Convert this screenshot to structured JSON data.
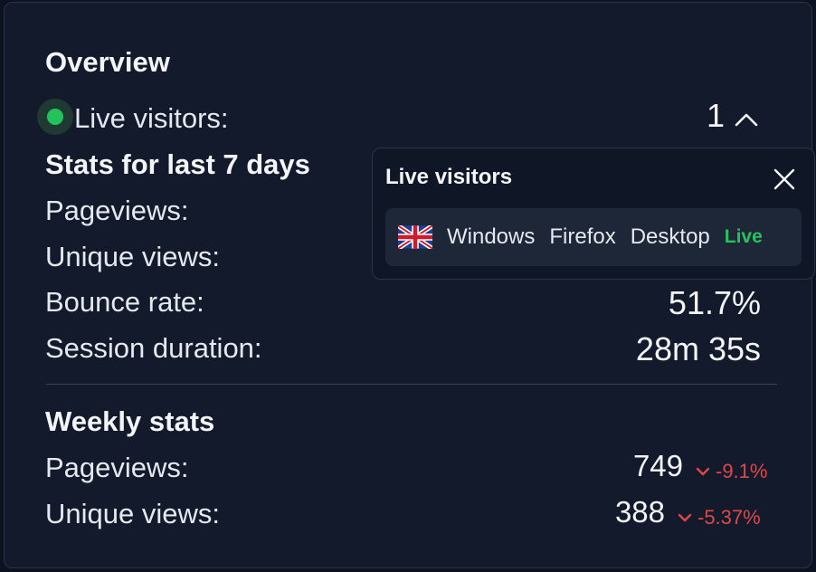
{
  "overview": {
    "title": "Overview",
    "live_label": "Live visitors:",
    "live_count": "1",
    "stats_title": "Stats for last 7 days",
    "pageviews_label": "Pageviews:",
    "unique_label": "Unique views:",
    "bounce_label": "Bounce rate:",
    "bounce_value": "51.7%",
    "session_label": "Session duration:",
    "session_value": "28m 35s"
  },
  "weekly": {
    "title": "Weekly stats",
    "pageviews_label": "Pageviews:",
    "pageviews_value": "749",
    "pageviews_change": "-9.1%",
    "unique_label": "Unique views:",
    "unique_value": "388",
    "unique_change": "-5.37%"
  },
  "popup": {
    "title": "Live visitors",
    "visitor": {
      "flag_icon": "uk-flag-icon",
      "os": "Windows",
      "browser": "Firefox",
      "device": "Desktop",
      "status": "Live"
    }
  },
  "colors": {
    "background": "#121a2c",
    "live_green": "#24c25c",
    "negative_red": "#e04848"
  }
}
